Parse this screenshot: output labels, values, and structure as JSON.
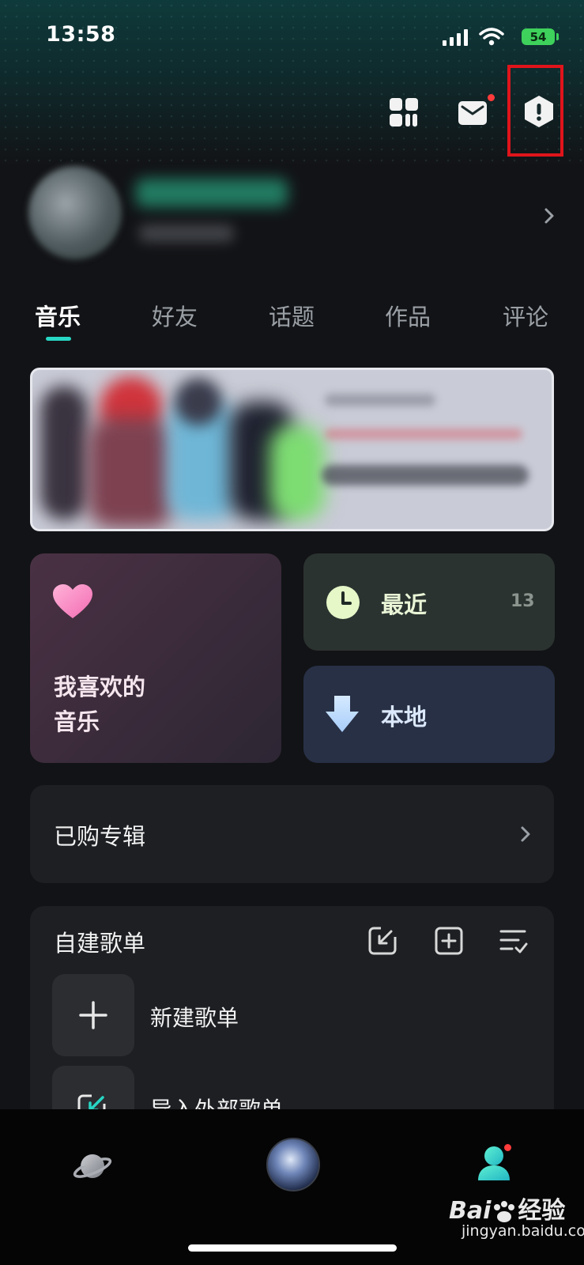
{
  "status_bar": {
    "time": "13:58",
    "battery": "54"
  },
  "header": {
    "icons": [
      "apps-grid-icon",
      "mail-icon",
      "hexagon-info-icon"
    ]
  },
  "profile": {
    "chevron": "›"
  },
  "tabs": [
    "音乐",
    "好友",
    "话题",
    "作品",
    "评论"
  ],
  "quick": {
    "favorites_line1": "我喜欢的",
    "favorites_line2": "音乐",
    "recent_label": "最近",
    "recent_count": "13",
    "local_label": "本地"
  },
  "purchased": {
    "label": "已购专辑"
  },
  "playlists": {
    "title": "自建歌单",
    "items": [
      {
        "label": "新建歌单"
      },
      {
        "label": "导入外部歌单"
      }
    ]
  },
  "watermark": {
    "brand": "Bai",
    "brand_suffix": "经验",
    "url": "jingyan.baidu.com"
  },
  "colors": {
    "accent": "#27d6c4",
    "highlight": "#e0141b",
    "notification": "#ff3b3b"
  }
}
